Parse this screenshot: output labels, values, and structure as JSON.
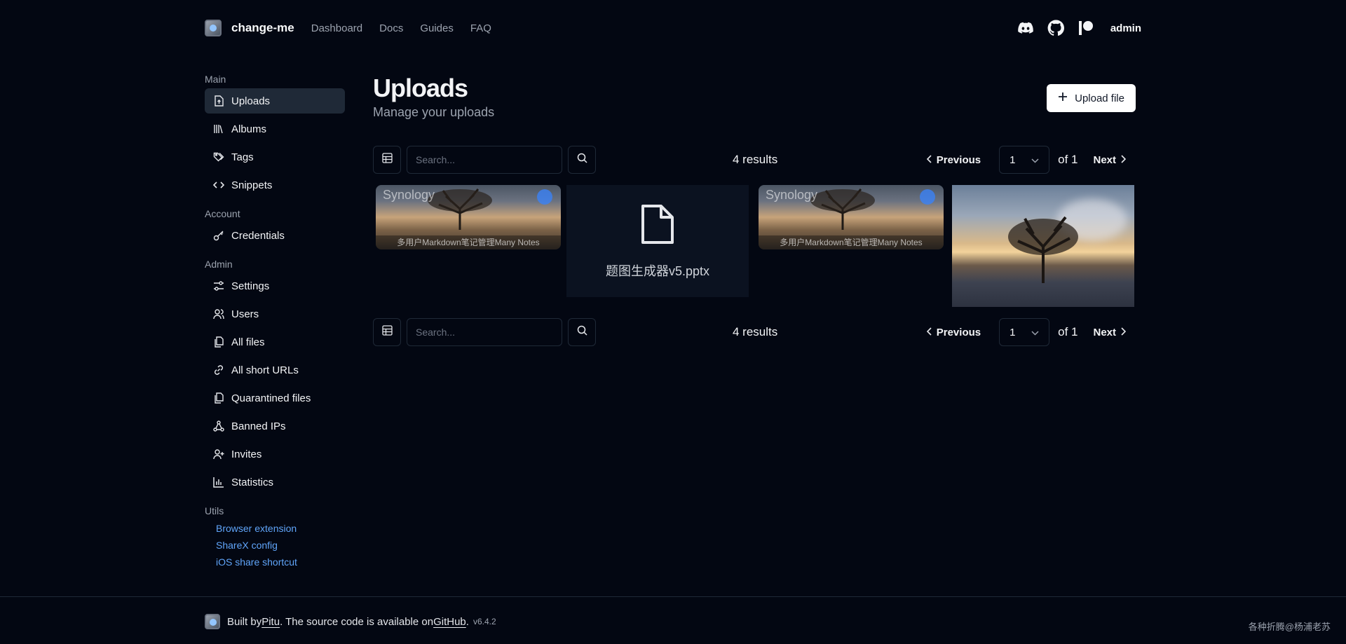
{
  "nav": {
    "brand": "change-me",
    "links": [
      "Dashboard",
      "Docs",
      "Guides",
      "FAQ"
    ],
    "icons": [
      "discord-icon",
      "github-icon",
      "patreon-icon"
    ],
    "user": "admin"
  },
  "sidebar": {
    "sections": [
      {
        "title": "Main",
        "items": [
          {
            "label": "Uploads",
            "icon": "file-upload-icon",
            "active": true
          },
          {
            "label": "Albums",
            "icon": "library-icon"
          },
          {
            "label": "Tags",
            "icon": "tags-icon"
          },
          {
            "label": "Snippets",
            "icon": "code-icon"
          }
        ]
      },
      {
        "title": "Account",
        "items": [
          {
            "label": "Credentials",
            "icon": "key-icon"
          }
        ]
      },
      {
        "title": "Admin",
        "items": [
          {
            "label": "Settings",
            "icon": "sliders-icon"
          },
          {
            "label": "Users",
            "icon": "users-icon"
          },
          {
            "label": "All files",
            "icon": "files-icon"
          },
          {
            "label": "All short URLs",
            "icon": "link-icon"
          },
          {
            "label": "Quarantined files",
            "icon": "files-icon"
          },
          {
            "label": "Banned IPs",
            "icon": "network-icon"
          },
          {
            "label": "Invites",
            "icon": "user-plus-icon"
          },
          {
            "label": "Statistics",
            "icon": "chart-icon"
          }
        ]
      }
    ],
    "utils": {
      "title": "Utils",
      "links": [
        "Browser extension",
        "ShareX config",
        "iOS share shortcut"
      ]
    }
  },
  "main": {
    "title": "Uploads",
    "subtitle": "Manage your uploads",
    "upload_label": "Upload file",
    "search_placeholder": "Search...",
    "results": "4 results",
    "previous": "Previous",
    "next": "Next",
    "page": "1",
    "of": "of 1",
    "files": [
      {
        "type": "image",
        "watermark": "Synology",
        "caption": "多用户Markdown笔记管理Many Notes"
      },
      {
        "type": "file",
        "name": "题图生成器v5.pptx"
      },
      {
        "type": "image",
        "watermark": "Synology",
        "caption": "多用户Markdown笔记管理Many Notes"
      },
      {
        "type": "photo"
      }
    ]
  },
  "footer": {
    "built_by": "Built by ",
    "author": "Pitu",
    "mid": ". The source code is available on ",
    "repo": "GitHub",
    "end": ".",
    "version": "v6.4.2",
    "credit": "各种折腾@杨浦老苏"
  }
}
